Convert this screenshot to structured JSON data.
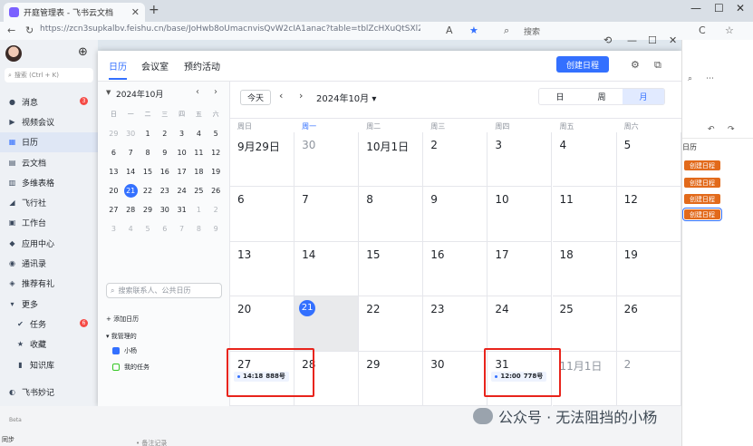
{
  "browser": {
    "tab_title": "开庭管理表 - 飞书云文档",
    "url": "https://zcn3supkalbv.feishu.cn/base/JoHwb8oUmacnvisQvW2cIA1anac?table=tblZcHXuQtSXl2pX&view=v...",
    "search_label": "搜索"
  },
  "sidebar": {
    "search_placeholder": "搜索 (Ctrl + K)",
    "items": [
      {
        "label": "消息",
        "icon": "chat-icon",
        "badge": "3"
      },
      {
        "label": "视频会议",
        "icon": "video-icon"
      },
      {
        "label": "日历",
        "icon": "calendar-icon",
        "active": true
      },
      {
        "label": "云文档",
        "icon": "doc-icon"
      },
      {
        "label": "多维表格",
        "icon": "table-icon"
      },
      {
        "label": "飞行社",
        "icon": "plane-icon"
      },
      {
        "label": "工作台",
        "icon": "grid-icon"
      },
      {
        "label": "应用中心",
        "icon": "apps-icon"
      },
      {
        "label": "通讯录",
        "icon": "contacts-icon"
      },
      {
        "label": "推荐有礼",
        "icon": "gift-icon"
      },
      {
        "label": "更多",
        "icon": "caret-icon"
      },
      {
        "label": "任务",
        "icon": "check-icon",
        "badge": "6"
      },
      {
        "label": "收藏",
        "icon": "star-icon"
      },
      {
        "label": "知识库",
        "icon": "book-icon"
      }
    ],
    "footer_label": "飞书妙记"
  },
  "calendar": {
    "tabs": [
      "日历",
      "会议室",
      "预约活动"
    ],
    "create_label": "创建日程",
    "mini": {
      "title": "2024年10月",
      "weekdays": [
        "日",
        "一",
        "二",
        "三",
        "四",
        "五",
        "六"
      ],
      "days": [
        "29",
        "30",
        "1",
        "2",
        "3",
        "4",
        "5",
        "6",
        "7",
        "8",
        "9",
        "10",
        "11",
        "12",
        "13",
        "14",
        "15",
        "16",
        "17",
        "18",
        "19",
        "20",
        "21",
        "22",
        "23",
        "24",
        "25",
        "26",
        "27",
        "28",
        "29",
        "30",
        "31",
        "1",
        "2",
        "3",
        "4",
        "5",
        "6",
        "7",
        "8",
        "9"
      ],
      "search_placeholder": "搜索联系人、公共日历",
      "add_calendar": "+ 添加日历",
      "managed_header": "我管理的",
      "calendars": [
        {
          "label": "小杨",
          "color": "#3370ff",
          "checked": true
        },
        {
          "label": "我的任务",
          "color": "#34c724",
          "checked": false
        }
      ]
    },
    "toolbar": {
      "today": "今天",
      "title": "2024年10月",
      "views": [
        "日",
        "周",
        "月"
      ],
      "active_view": "月"
    },
    "week_headers": [
      "周日",
      "周一",
      "周二",
      "周三",
      "周四",
      "周五",
      "周六"
    ],
    "weeks": [
      [
        "9月29日",
        "30",
        "10月1日",
        "2",
        "3",
        "4",
        "5"
      ],
      [
        "6",
        "7",
        "8",
        "9",
        "10",
        "11",
        "12"
      ],
      [
        "13",
        "14",
        "15",
        "16",
        "17",
        "18",
        "19"
      ],
      [
        "20",
        "21",
        "22",
        "23",
        "24",
        "25",
        "26"
      ],
      [
        "27",
        "28",
        "29",
        "30",
        "31",
        "11月1日",
        "2"
      ]
    ],
    "events": [
      {
        "time": "14:18",
        "title": "888号"
      },
      {
        "time": "12:00",
        "title": "778号"
      }
    ]
  },
  "background_doc": {
    "column_label": "日历",
    "chip_label": "创建日程"
  },
  "bottom": {
    "beta": "Beta",
    "sync": "同步",
    "foot": "• 备注记录"
  },
  "watermark": "公众号 · 无法阻挡的小杨"
}
